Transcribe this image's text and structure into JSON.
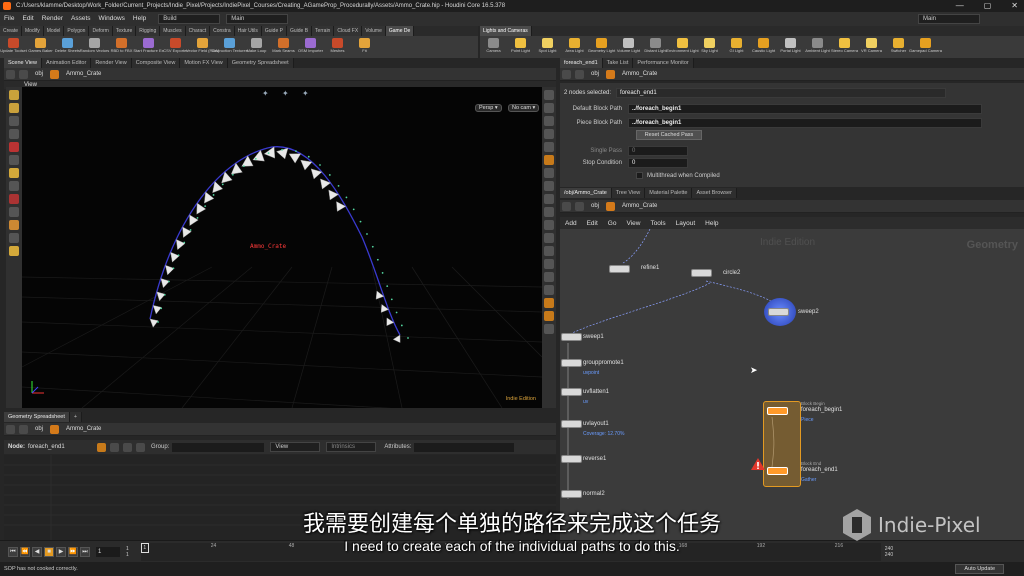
{
  "window": {
    "title": "C:/Users/klamme/Desktop/Work_Folder/Current_Projects/Indie_Pixel/Projects/IndiePixel_Courses/Creating_AGameProp_Procedurally/Assets/Ammo_Crate.hip - Houdini Core 16.5.378",
    "controls": [
      "—",
      "▢",
      "✕"
    ]
  },
  "menu": {
    "items": [
      "File",
      "Edit",
      "Render",
      "Assets",
      "Windows",
      "Help"
    ],
    "build_label": "Build",
    "main_label": "Main",
    "desktop_label": "Main"
  },
  "shelf_left": {
    "tabs": [
      "Create",
      "Modify",
      "Model",
      "Polygon",
      "Deform",
      "Texture",
      "Rigging",
      "Muscles",
      "Charact",
      "Constra",
      "Hair Utils",
      "Guide P",
      "Guide B",
      "Terrain",
      "Cloud FX",
      "Volume",
      "Game De"
    ],
    "active_tab": 16,
    "tools": [
      "Update Toolset",
      "Games Baker",
      "Delete Sheets",
      "Random Vectors",
      "RBD to FBX",
      "Start Fracture Ex",
      "CSV Exporter",
      "Vector Field (FGA)",
      "Destruction Textures",
      "Make Loop",
      "Mark Seams",
      "OSM Importer",
      "Meshes",
      "Fit"
    ]
  },
  "shelf_right": {
    "tabs": [
      "Lights and Cameras"
    ],
    "tools": [
      "Camera",
      "Point Light",
      "Spot Light",
      "Area Light",
      "Geometry Light",
      "Volume Light",
      "Distant Light",
      "Environment Light",
      "Sky Light",
      "GI Light",
      "Caustic Light",
      "Portal Light",
      "Ambient Light",
      "Stereo Camera",
      "VR Camera",
      "Switcher",
      "Gamepad Camera"
    ]
  },
  "viewer": {
    "tabs": [
      "Scene View",
      "Animation Editor",
      "Render View",
      "Composite View",
      "Motion FX View",
      "Geometry Spreadsheet"
    ],
    "path": [
      "obj",
      "Ammo_Crate"
    ],
    "title": "View",
    "persp_label": "Persp ▾",
    "cam_label": "No cam ▾",
    "object_label": "Ammo_Crate",
    "edition_label": "Indie Edition"
  },
  "spreadsheet": {
    "tab": "Geometry Spreadsheet",
    "path": [
      "obj",
      "Ammo_Crate"
    ],
    "node_label": "Node:",
    "node_value": "foreach_end1",
    "group_label": "Group:",
    "view_label": "View",
    "intrinsics_label": "Intrinsics",
    "attributes_label": "Attributes:"
  },
  "params": {
    "tabs": [
      "foreach_end1",
      "Take List",
      "Performance Monitor"
    ],
    "path": [
      "obj",
      "Ammo_Crate"
    ],
    "selected_label": "2 nodes selected:",
    "selected_value": "foreach_end1",
    "rows": [
      {
        "label": "Default Block Path",
        "value": "../foreach_begin1"
      },
      {
        "label": "Piece Block Path",
        "value": "../foreach_begin1"
      }
    ],
    "reset_button": "Reset Cached Pass",
    "single_pass_label": "Single Pass",
    "single_pass_value": "0",
    "stop_condition_label": "Stop Condition",
    "stop_condition_value": "0",
    "multithread_label": "Multithread when Compiled"
  },
  "network": {
    "tabs": [
      "/obj/Ammo_Crate",
      "Tree View",
      "Material Palette",
      "Asset Browser"
    ],
    "path": [
      "obj",
      "Ammo_Crate"
    ],
    "menu": [
      "Add",
      "Edit",
      "Go",
      "View",
      "Tools",
      "Layout",
      "Help"
    ],
    "watermark_edition": "Indie Edition",
    "watermark_context": "Geometry",
    "nodes": [
      {
        "name": "refine1",
        "sub": ""
      },
      {
        "name": "circle2",
        "sub": ""
      },
      {
        "name": "sweep2",
        "sub": ""
      },
      {
        "name": "sweep1",
        "sub": ""
      },
      {
        "name": "grouppromote1",
        "sub": "uvpoint"
      },
      {
        "name": "uvflatten1",
        "sub": "uv"
      },
      {
        "name": "uvlayout1",
        "sub": "Coverage: 12.70%"
      },
      {
        "name": "reverse1",
        "sub": ""
      },
      {
        "name": "normal2",
        "sub": ""
      },
      {
        "name": "foreach_begin1",
        "sub": "Piece",
        "header": "Block Begin"
      },
      {
        "name": "foreach_end1",
        "sub": "Gather",
        "header": "Block End"
      }
    ]
  },
  "subtitles": {
    "chinese": "我需要创建每个单独的路径来完成这个任务",
    "english": "I need to create each of the individual paths to do this."
  },
  "brand": {
    "name": "Indie-Pixel"
  },
  "timeline": {
    "current_frame": "1",
    "start": "1",
    "start2": "1",
    "ticks": [
      "24",
      "48",
      "72",
      "96",
      "120",
      "144",
      "168",
      "192",
      "216"
    ],
    "end": "240",
    "end2": "240"
  },
  "status": {
    "message": "SOP has not cooked correctly.",
    "auto_update": "Auto Update"
  },
  "colors": {
    "accent": "#ff8a1f",
    "node_blue": "#6a9cff",
    "block": "#e39a22"
  }
}
